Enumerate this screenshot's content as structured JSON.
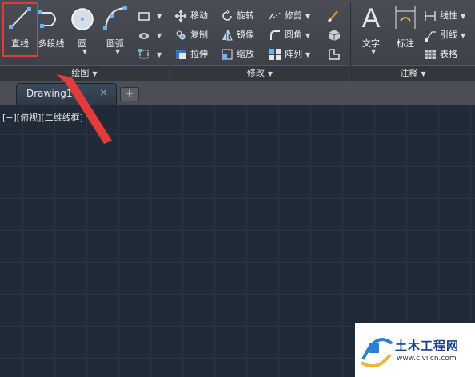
{
  "ribbon": {
    "draw": {
      "line": "直线",
      "polyline": "多段线",
      "circle": "圆",
      "arc": "圆弧",
      "panel_title": "绘图"
    },
    "modify": {
      "move": "移动",
      "rotate": "旋转",
      "trim": "修剪",
      "copy": "复制",
      "mirror": "镜像",
      "fillet": "圆角",
      "stretch": "拉伸",
      "scale": "缩放",
      "array": "阵列",
      "panel_title": "修改"
    },
    "annotation": {
      "text": "文字",
      "dimension": "标注",
      "linear": "线性",
      "leader": "引线",
      "table": "表格",
      "panel_title": "注释"
    }
  },
  "tabs": {
    "drawing_tab": "Drawing1",
    "close_symbol": "×",
    "new_tab_symbol": "+"
  },
  "viewport": {
    "label": "[−][俯视][二维线框]"
  },
  "watermark": {
    "title": "土木工程网",
    "url": "www.civilcn.com"
  },
  "colors": {
    "ribbon_bg": "#3f4348",
    "canvas_bg": "#212b37",
    "grid": "#2b3746",
    "highlight": "#e23b3b",
    "accent": "#2f7fd1"
  }
}
